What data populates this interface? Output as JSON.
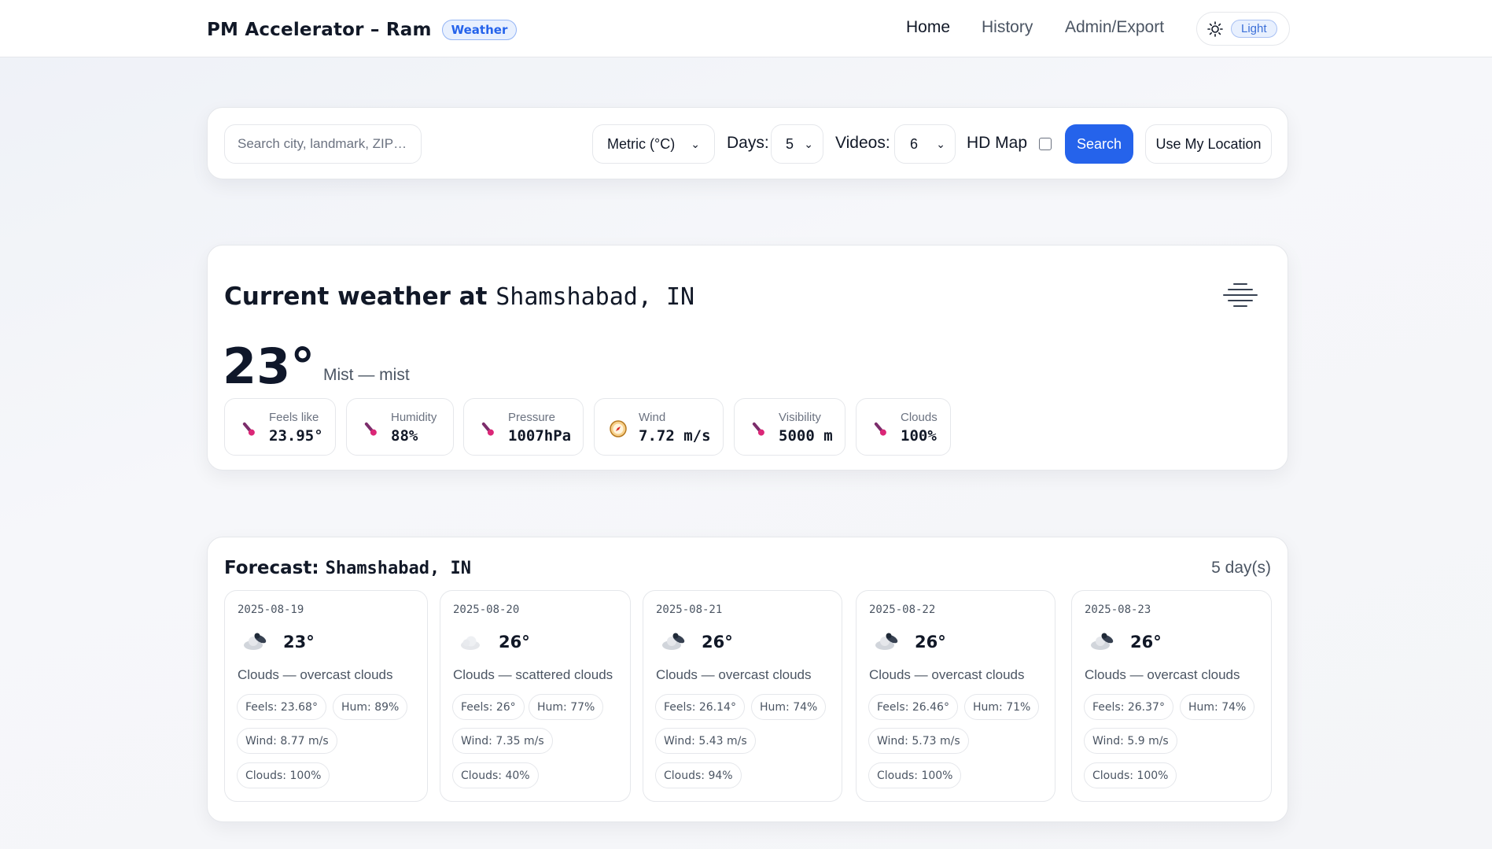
{
  "header": {
    "brand_title": "PM Accelerator – Ram",
    "brand_badge": "Weather",
    "nav": [
      {
        "label": "Home",
        "active": true
      },
      {
        "label": "History",
        "active": false
      },
      {
        "label": "Admin/Export",
        "active": false
      }
    ],
    "theme_icon": "sun-icon",
    "theme_label": "Light"
  },
  "search": {
    "placeholder": "Search city, landmark, ZIP…",
    "value": "",
    "units_selected": "Metric (°C)",
    "days_label": "Days:",
    "days_selected": "5",
    "videos_label": "Videos:",
    "videos_selected": "6",
    "hd_map_label": "HD Map",
    "hd_map_checked": false,
    "search_button": "Search",
    "location_button": "Use My Location",
    "accent_color": "#2563eb"
  },
  "current": {
    "title_prefix": "Current weather at",
    "location": "Shamshabad, IN",
    "condition_icon": "mist-icon",
    "temperature": "23°",
    "description": "Mist — mist",
    "stats": [
      {
        "label": "Feels like",
        "value": "23.95°",
        "icon": "thermometer-icon"
      },
      {
        "label": "Humidity",
        "value": "88%",
        "icon": "thermometer-icon"
      },
      {
        "label": "Pressure",
        "value": "1007hPa",
        "icon": "thermometer-icon"
      },
      {
        "label": "Wind",
        "value": "7.72 m/s",
        "icon": "compass-icon"
      },
      {
        "label": "Visibility",
        "value": "5000 m",
        "icon": "thermometer-icon"
      },
      {
        "label": "Clouds",
        "value": "100%",
        "icon": "thermometer-icon"
      }
    ]
  },
  "forecast": {
    "title_prefix": "Forecast:",
    "location": "Shamshabad, IN",
    "days_count": "5 day(s)",
    "days": [
      {
        "date": "2025-08-19",
        "icon": "overcast-clouds-icon",
        "temp": "23°",
        "desc": "Clouds — overcast clouds",
        "feels": "Feels: 23.68°",
        "hum": "Hum: 89%",
        "wind": "Wind: 8.77 m/s",
        "clouds": "Clouds: 100%"
      },
      {
        "date": "2025-08-20",
        "icon": "scattered-clouds-icon",
        "temp": "26°",
        "desc": "Clouds — scattered clouds",
        "feels": "Feels: 26°",
        "hum": "Hum: 77%",
        "wind": "Wind: 7.35 m/s",
        "clouds": "Clouds: 40%"
      },
      {
        "date": "2025-08-21",
        "icon": "overcast-clouds-icon",
        "temp": "26°",
        "desc": "Clouds — overcast clouds",
        "feels": "Feels: 26.14°",
        "hum": "Hum: 74%",
        "wind": "Wind: 5.43 m/s",
        "clouds": "Clouds: 94%"
      },
      {
        "date": "2025-08-22",
        "icon": "overcast-clouds-icon",
        "temp": "26°",
        "desc": "Clouds — overcast clouds",
        "feels": "Feels: 26.46°",
        "hum": "Hum: 71%",
        "wind": "Wind: 5.73 m/s",
        "clouds": "Clouds: 100%"
      },
      {
        "date": "2025-08-23",
        "icon": "overcast-clouds-icon",
        "temp": "26°",
        "desc": "Clouds — overcast clouds",
        "feels": "Feels: 26.37°",
        "hum": "Hum: 74%",
        "wind": "Wind: 5.9 m/s",
        "clouds": "Clouds: 100%"
      }
    ]
  }
}
